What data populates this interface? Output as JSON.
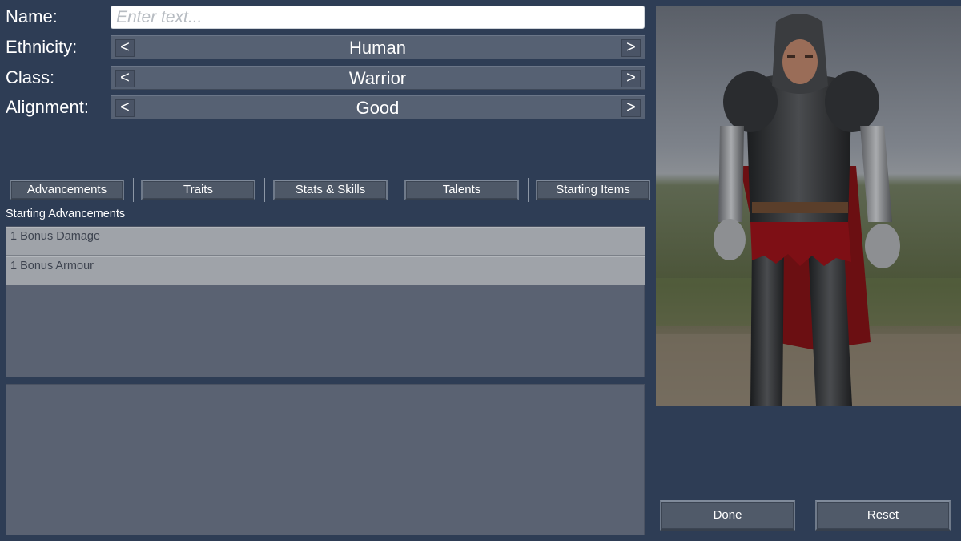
{
  "form": {
    "name_label": "Name:",
    "name_placeholder": "Enter text...",
    "name_value": "",
    "ethnicity_label": "Ethnicity:",
    "ethnicity_value": "Human",
    "class_label": "Class:",
    "class_value": "Warrior",
    "alignment_label": "Alignment:",
    "alignment_value": "Good",
    "prev_glyph": "<",
    "next_glyph": ">"
  },
  "tabs": [
    {
      "label": "Advancements"
    },
    {
      "label": "Traits"
    },
    {
      "label": "Stats & Skills"
    },
    {
      "label": "Talents"
    },
    {
      "label": "Starting Items"
    }
  ],
  "section": {
    "title": "Starting Advancements",
    "items": [
      {
        "label": "1 Bonus Damage"
      },
      {
        "label": "1 Bonus Armour"
      }
    ]
  },
  "portrait": {
    "icon": "armored-warrior-portrait"
  },
  "actions": {
    "done_label": "Done",
    "reset_label": "Reset"
  },
  "colors": {
    "background": "#2e3d55",
    "panel": "#5a6272",
    "list_item": "#9fa3a9",
    "button": "#505a69"
  }
}
